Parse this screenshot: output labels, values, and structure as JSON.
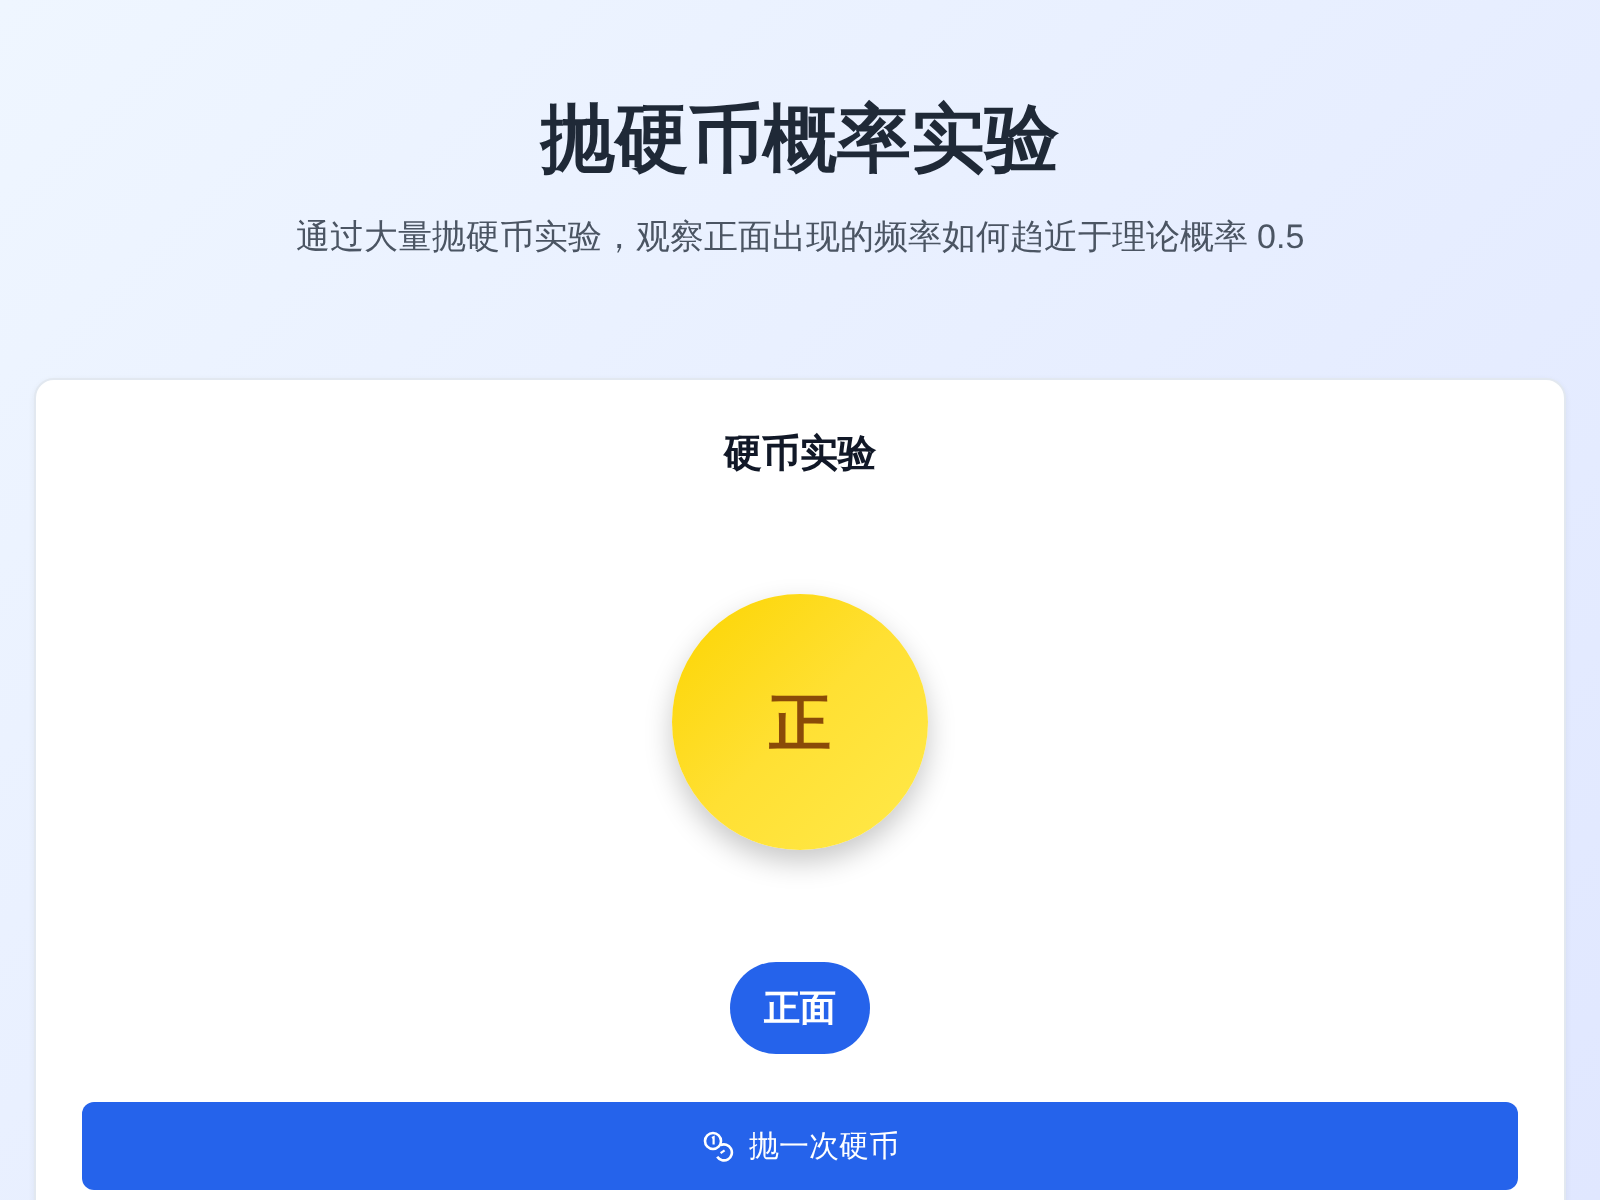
{
  "header": {
    "title": "抛硬币概率实验",
    "subtitle": "通过大量抛硬币实验，观察正面出现的频率如何趋近于理论概率 0.5"
  },
  "card": {
    "title": "硬币实验",
    "coin": {
      "face": "正"
    },
    "result_badge": "正面",
    "toss_button": {
      "label": "抛一次硬币"
    }
  }
}
